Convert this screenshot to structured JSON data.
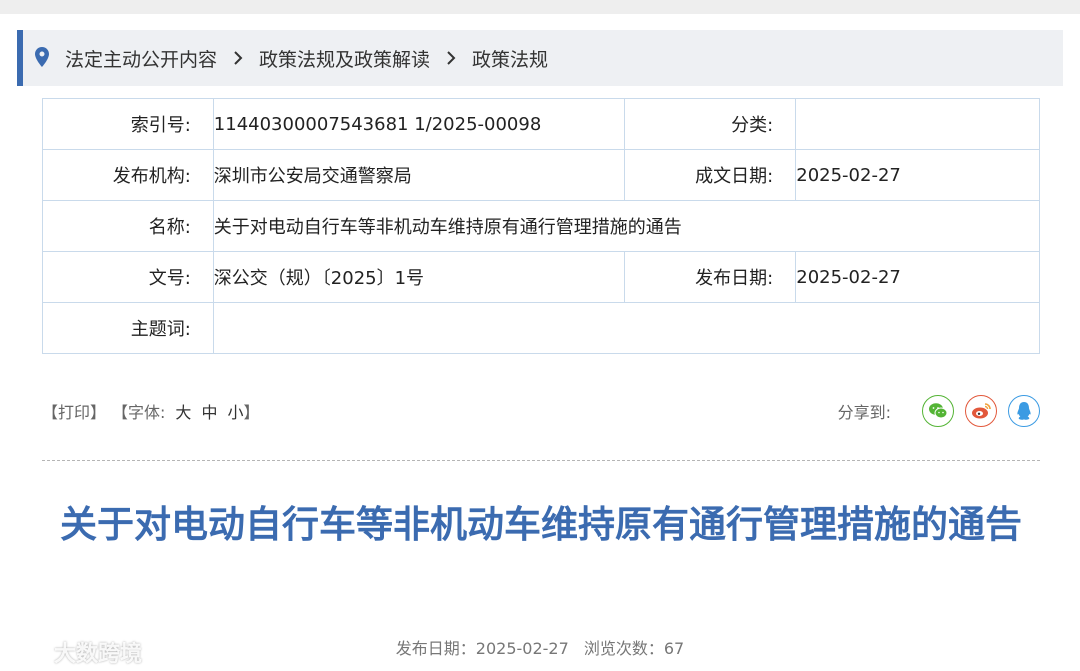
{
  "breadcrumb": {
    "items": [
      "法定主动公开内容",
      "政策法规及政策解读",
      "政策法规"
    ]
  },
  "meta": {
    "index_label": "索引号:",
    "index_value": "11440300007543681 1/2025-00098",
    "category_label": "分类:",
    "category_value": "",
    "publisher_label": "发布机构:",
    "publisher_value": "深圳市公安局交通警察局",
    "created_label": "成文日期:",
    "created_value": "2025-02-27",
    "name_label": "名称:",
    "name_value": "关于对电动自行车等非机动车维持原有通行管理措施的通告",
    "docno_label": "文号:",
    "docno_value": "深公交（规）〔2025〕1号",
    "pubdate_label": "发布日期:",
    "pubdate_value": "2025-02-27",
    "keywords_label": "主题词:",
    "keywords_value": ""
  },
  "tools": {
    "print": "【打印】",
    "font_prefix": "【字体:",
    "font_large": "大",
    "font_medium": "中",
    "font_small": "小",
    "font_suffix": "】",
    "share_label": "分享到:"
  },
  "share_icons": [
    "wechat-icon",
    "weibo-icon",
    "qq-icon"
  ],
  "colors": {
    "accent": "#3b6bb0",
    "wechat": "#54b435",
    "weibo": "#e2583b",
    "qq": "#3b9be3"
  },
  "article": {
    "title": "关于对电动自行车等非机动车维持原有通行管理措施的通告",
    "pub_label": "发布日期：",
    "pub_date": "2025-02-27",
    "views_label": "浏览次数：",
    "views": "67"
  },
  "watermark": {
    "text": "大数跨境"
  }
}
